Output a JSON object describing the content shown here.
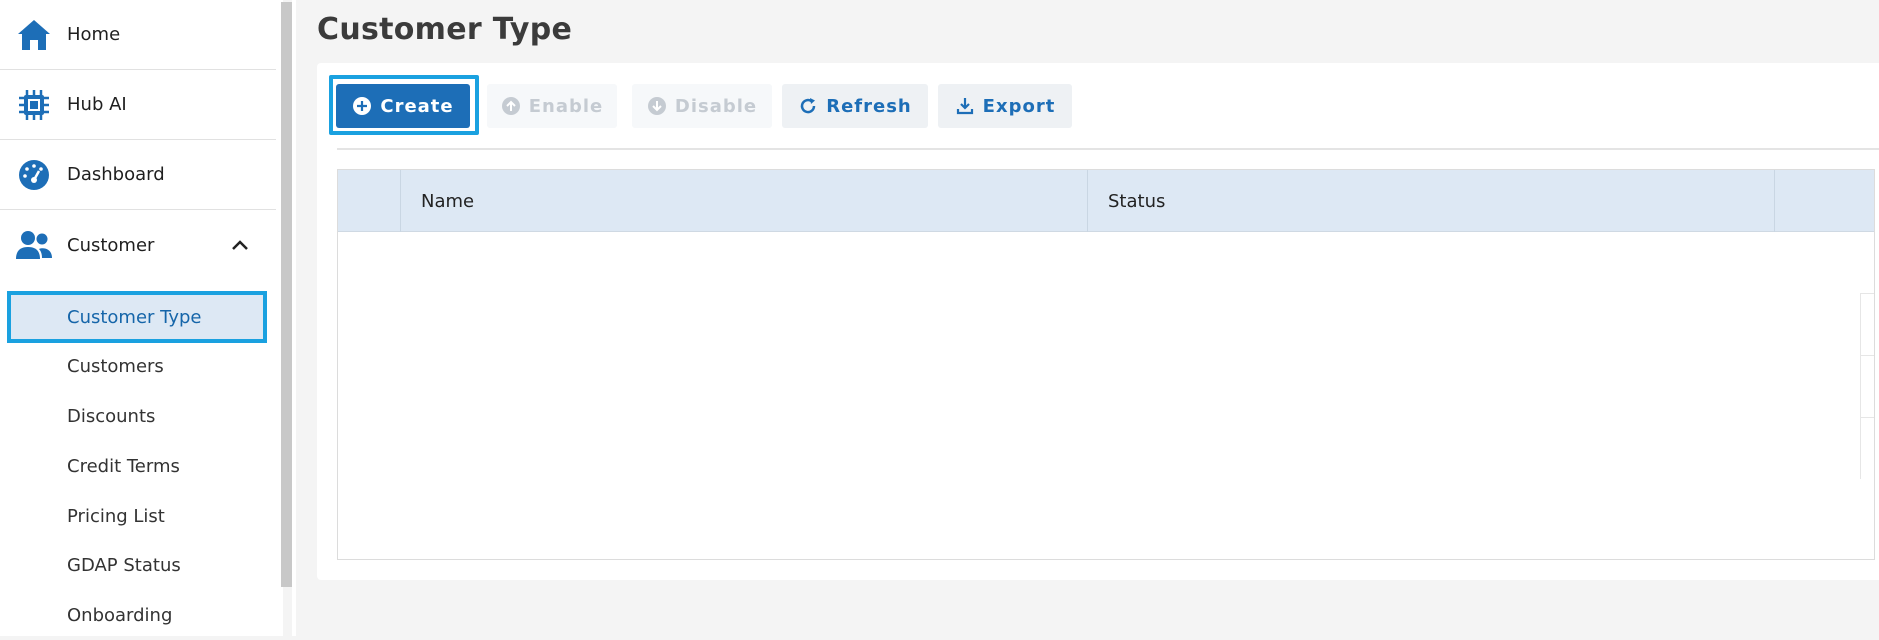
{
  "sidebar": {
    "nav": [
      {
        "label": "Home",
        "icon": "home-icon"
      },
      {
        "label": "Hub AI",
        "icon": "chip-icon"
      },
      {
        "label": "Dashboard",
        "icon": "dashboard-gauge-icon"
      },
      {
        "label": "Customer",
        "icon": "users-icon",
        "expanded": true
      }
    ],
    "customer_sub": [
      {
        "label": "Customer Type",
        "active": true
      },
      {
        "label": "Customers"
      },
      {
        "label": "Discounts"
      },
      {
        "label": "Credit Terms"
      },
      {
        "label": "Pricing List"
      },
      {
        "label": "GDAP Status"
      },
      {
        "label": "Onboarding"
      }
    ]
  },
  "page": {
    "title": "Customer Type"
  },
  "toolbar": {
    "create_label": "Create",
    "enable_label": "Enable",
    "disable_label": "Disable",
    "refresh_label": "Refresh",
    "export_label": "Export"
  },
  "grid": {
    "columns": [
      "Name",
      "Status"
    ],
    "rows": []
  },
  "colors": {
    "accent": "#1d6eb7",
    "highlight_outline": "#1aa1e0",
    "header_bg": "#dde8f4",
    "disabled_text": "#c5cbd2"
  }
}
